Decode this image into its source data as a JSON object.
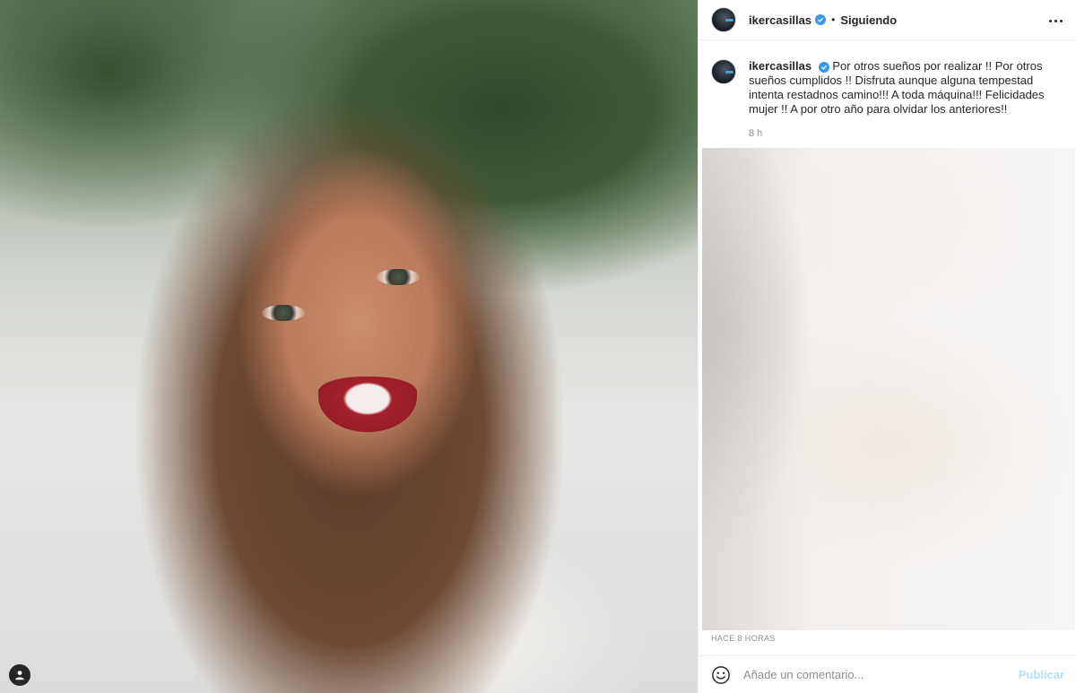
{
  "post": {
    "username": "ikercasillas",
    "follow_status": "Siguiendo",
    "separator": "•",
    "caption": "Por otros sueños por realizar !! Por otros sueños cumplidos !! Disfruta aunque alguna tempestad intenta restadnos camino!!! A toda máquina!!! Felicidades mujer !! A por otro año para olvidar los anteriores!!",
    "time_ago": "8 h",
    "timestamp": "HACE 8 HORAS"
  },
  "comment": {
    "placeholder": "Añade un comentario...",
    "publish_label": "Publicar"
  },
  "colors": {
    "verified": "#3897f0",
    "publish_disabled": "#b2dffc",
    "muted_text": "#8e8e8e"
  },
  "icons": {
    "verified": "verified-badge-icon",
    "more": "more-options-icon",
    "emoji": "emoji-icon",
    "user_tag": "user-tag-icon"
  }
}
